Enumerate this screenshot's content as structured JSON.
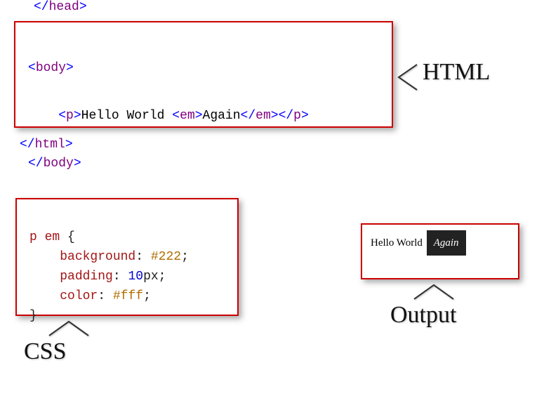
{
  "stray": {
    "head_close": "</head>",
    "html_close": "</html>"
  },
  "html_panel": {
    "line1": {
      "open": "<body>"
    },
    "line2": {
      "p_open": "<p>",
      "text1": "Hello World ",
      "em_open": "<em>",
      "text2": "Again",
      "em_close": "</em>",
      "p_close": "</p>"
    },
    "line3": {
      "close": "</body>"
    }
  },
  "css_panel": {
    "selector": "p em",
    "brace_open": "{",
    "prop1": "background",
    "val1": "#222",
    "prop2": "padding",
    "val2_num": "10",
    "val2_unit": "px",
    "prop3": "color",
    "val3": "#fff",
    "brace_close": "}"
  },
  "output_panel": {
    "plain": "Hello World ",
    "highlighted": "Again"
  },
  "labels": {
    "html": "HTML",
    "css": "CSS",
    "output": "Output"
  }
}
